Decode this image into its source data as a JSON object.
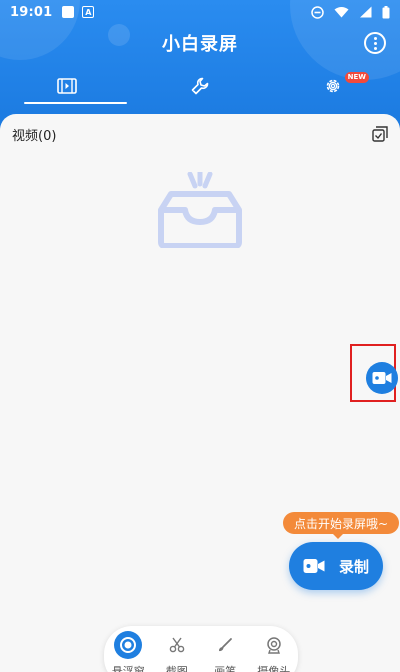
{
  "status_bar": {
    "time": "19:01",
    "notification_letter": "A"
  },
  "header": {
    "title": "小白录屏"
  },
  "tabs": [
    {
      "id": "videos",
      "icon": "video-file-icon",
      "active": true
    },
    {
      "id": "tools",
      "icon": "wrench-icon",
      "active": false
    },
    {
      "id": "settings",
      "icon": "gear-icon",
      "active": false,
      "badge": "NEW"
    }
  ],
  "content": {
    "videos_label": "视频(0)",
    "empty_icon": "empty-inbox-icon"
  },
  "record": {
    "tip": "点击开始录屏哦~",
    "label": "录制"
  },
  "bottom_bar": [
    {
      "id": "floating-window",
      "label": "悬浮窗",
      "icon": "floating-window-icon"
    },
    {
      "id": "screenshot",
      "label": "截图",
      "icon": "scissors-icon"
    },
    {
      "id": "brush",
      "label": "画笔",
      "icon": "brush-icon"
    },
    {
      "id": "camera",
      "label": "摄像头",
      "icon": "webcam-icon"
    }
  ],
  "colors": {
    "primary": "#1f7fe0",
    "tip": "#f38a3a",
    "badge": "#f24a3c",
    "content_bg": "#f7f7f7"
  }
}
